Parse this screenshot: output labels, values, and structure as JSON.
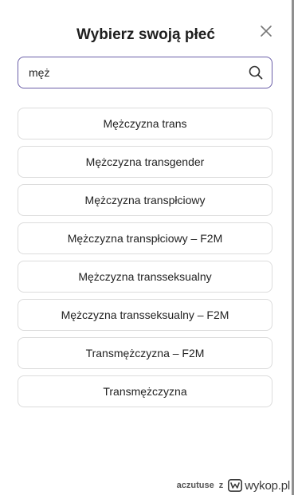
{
  "dialog": {
    "title": "Wybierz swoją płeć",
    "close_icon": "close-icon"
  },
  "search": {
    "value": "męż",
    "icon": "search-icon"
  },
  "options": [
    {
      "label": "Mężczyzna trans"
    },
    {
      "label": "Mężczyzna transgender"
    },
    {
      "label": "Mężczyzna transpłciowy"
    },
    {
      "label": "Mężczyzna transpłciowy – F2M"
    },
    {
      "label": "Mężczyzna transseksualny"
    },
    {
      "label": "Mężczyzna transseksualny – F2M"
    },
    {
      "label": "Transmężczyzna – F2M"
    },
    {
      "label": "Transmężczyzna"
    }
  ],
  "footer": {
    "author": "aczutuse",
    "separator": "z",
    "logo_text": "wykop.pl",
    "logo_icon": "wykop-logo-icon"
  },
  "colors": {
    "input_border": "#6b5fa8",
    "option_border": "#dcdcdc",
    "spellcheck_underline": "#d0342c"
  }
}
